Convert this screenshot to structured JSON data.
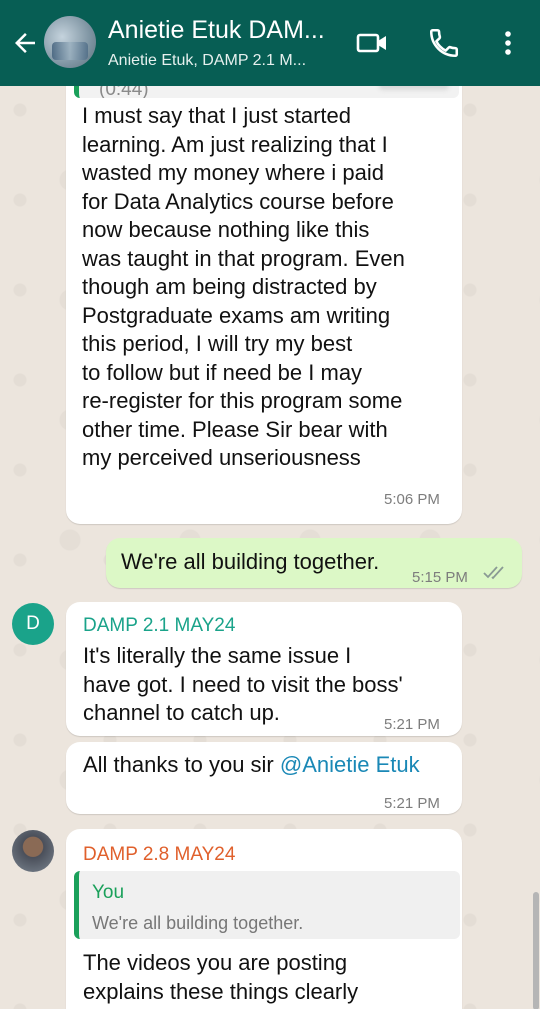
{
  "header": {
    "title": "Anietie Etuk DAM...",
    "subtitle": "Anietie Etuk, DAMP 2.1 M..."
  },
  "messages": {
    "msg1": {
      "quote_duration": "(0:44)",
      "lines": [
        "I must say that I just started",
        "learning. Am just realizing that I",
        "wasted my money where i paid",
        "for Data Analytics course before",
        "now because nothing like this",
        "was taught in that program. Even",
        "though am being distracted by",
        "Postgraduate exams am writing",
        "this period, I will try my best",
        "to follow but if need be I may",
        "re-register for this program some",
        "other time. Please Sir bear with",
        "my perceived  unseriousness"
      ],
      "time": "5:06 PM"
    },
    "msg2": {
      "text": "We're all building together.",
      "time": "5:15 PM"
    },
    "msg3": {
      "avatar_letter": "D",
      "sender": "DAMP 2.1 MAY24",
      "lines": [
        "It's literally the same issue I",
        "have got. I need to visit the boss'",
        "channel to catch up."
      ],
      "time": "5:21 PM"
    },
    "msg4": {
      "text_prefix": "All thanks to you sir ",
      "mention": "@Anietie Etuk",
      "time": "5:21 PM"
    },
    "msg5": {
      "sender": "DAMP 2.8 MAY24",
      "quote_author": "You",
      "quote_text": "We're all building together.",
      "lines": [
        "The videos you are posting",
        "explains these things clearly"
      ]
    }
  },
  "colors": {
    "header": "#075e54",
    "outgoing_bubble": "#dcf8c6",
    "sender_teal": "#1aa38a",
    "sender_orange": "#e0602c",
    "mention": "#1a88b6",
    "read_tick": "#8a9a94"
  }
}
